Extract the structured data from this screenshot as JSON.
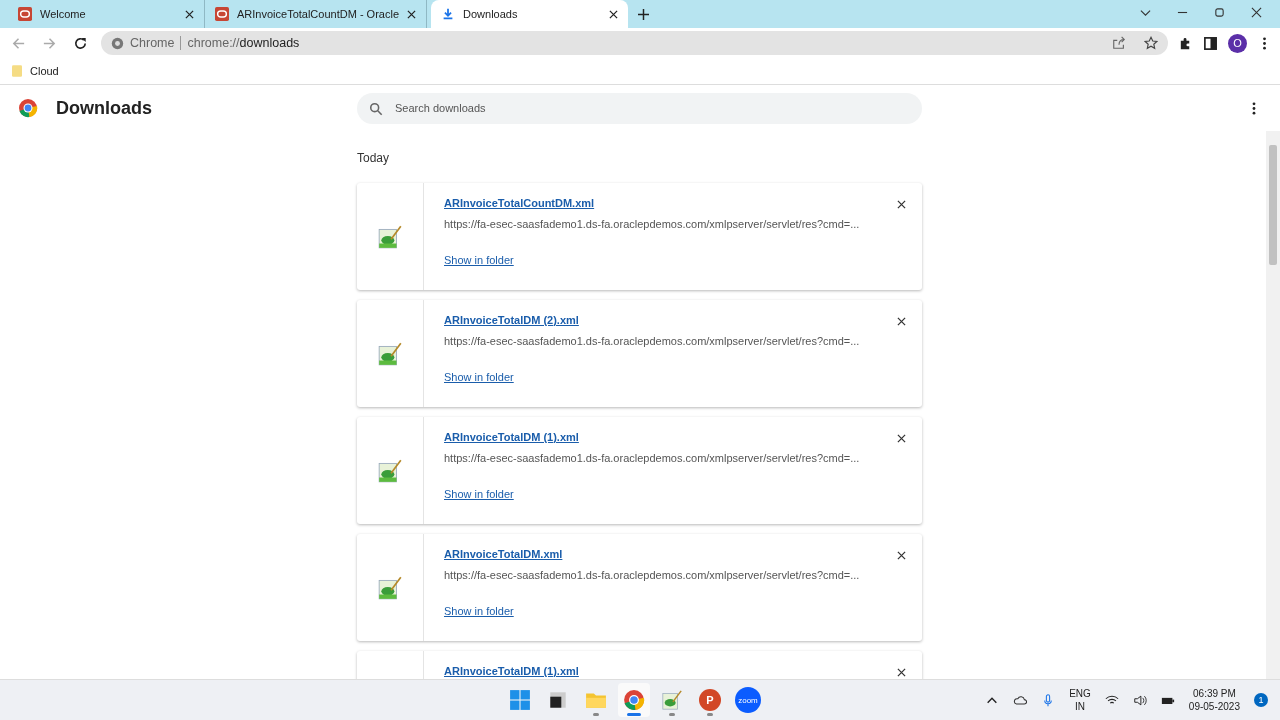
{
  "tabs": [
    {
      "title": "Welcome",
      "kind": "oracle",
      "selected": false
    },
    {
      "title": "ARInvoiceTotalCountDM - Oracle",
      "kind": "oracle",
      "selected": false
    },
    {
      "title": "Downloads",
      "kind": "download",
      "selected": true
    }
  ],
  "omnibox": {
    "scheme_label": "Chrome",
    "url_prefix": "chrome://",
    "url_host": "downloads"
  },
  "profile": {
    "initial": "O"
  },
  "bookmarks": [
    {
      "label": "Cloud"
    }
  ],
  "page": {
    "title": "Downloads",
    "search": {
      "placeholder": "Search downloads"
    },
    "section": "Today",
    "downloads": [
      {
        "name": "ARInvoiceTotalCountDM.xml",
        "url": "https://fa-esec-saasfademo1.ds-fa.oraclepdemos.com/xmlpserver/servlet/res?cmd=...",
        "action": "Show in folder"
      },
      {
        "name": "ARInvoiceTotalDM (2).xml",
        "url": "https://fa-esec-saasfademo1.ds-fa.oraclepdemos.com/xmlpserver/servlet/res?cmd=...",
        "action": "Show in folder"
      },
      {
        "name": "ARInvoiceTotalDM (1).xml",
        "url": "https://fa-esec-saasfademo1.ds-fa.oraclepdemos.com/xmlpserver/servlet/res?cmd=...",
        "action": "Show in folder"
      },
      {
        "name": "ARInvoiceTotalDM.xml",
        "url": "https://fa-esec-saasfademo1.ds-fa.oraclepdemos.com/xmlpserver/servlet/res?cmd=...",
        "action": "Show in folder"
      },
      {
        "name": "ARInvoiceTotalDM (1).xml"
      }
    ]
  },
  "taskbar": {
    "apps": [
      {
        "kind": "start",
        "running": false,
        "selected": false
      },
      {
        "kind": "taskview",
        "running": false,
        "selected": false
      },
      {
        "kind": "folder",
        "running": true,
        "selected": false
      },
      {
        "kind": "chrome",
        "running": true,
        "selected": true
      },
      {
        "kind": "editor",
        "running": true,
        "selected": false
      },
      {
        "kind": "powerpoint",
        "label": "P",
        "running": true,
        "selected": false
      },
      {
        "kind": "zoom",
        "label": "zoom",
        "running": false,
        "selected": false
      }
    ],
    "language": "ENG",
    "region": "IN",
    "time": "06:39 PM",
    "date": "09-05-2023",
    "notifications": "1"
  }
}
